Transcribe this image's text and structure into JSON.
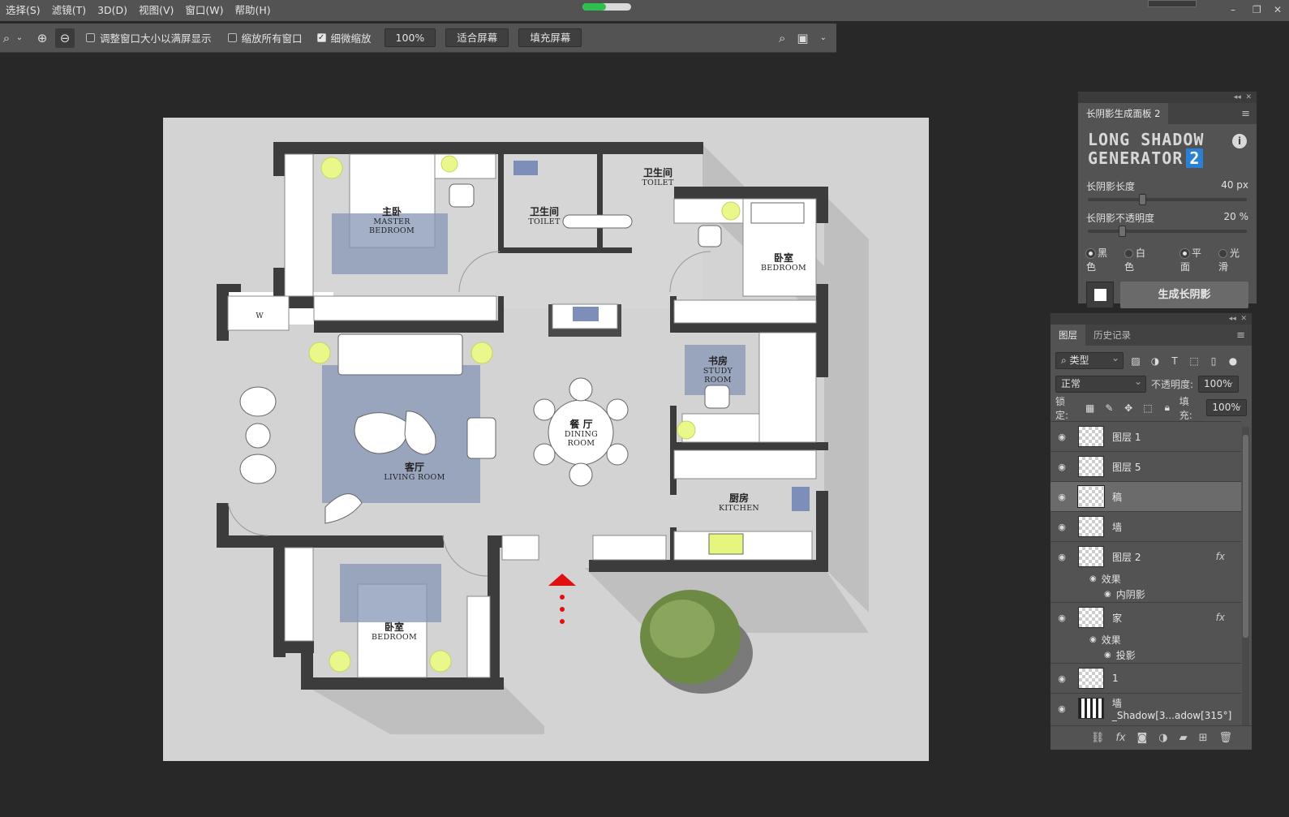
{
  "menu": [
    "选择(S)",
    "滤镜(T)",
    "3D(D)",
    "视图(V)",
    "窗口(W)",
    "帮助(H)"
  ],
  "progress_fraction": 0.48,
  "options_bar": {
    "chk_resize": "调整窗口大小以满屏显示",
    "chk_zoom_all": "缩放所有窗口",
    "chk_scrubby": "细微缩放",
    "zoom_value": "100%",
    "fit_screen": "适合屏幕",
    "fill_screen": "填充屏幕"
  },
  "plan": {
    "rooms": [
      {
        "cn": "主卧",
        "en": "MASTER BEDROOM"
      },
      {
        "cn": "卫生间",
        "en": "TOILET"
      },
      {
        "cn": "卫生间",
        "en": "TOILET"
      },
      {
        "cn": "卧室",
        "en": "BEDROOM"
      },
      {
        "cn": "书房",
        "en": "STUDY ROOM"
      },
      {
        "cn": "餐 厅",
        "en": "DINING ROOM"
      },
      {
        "cn": "客厅",
        "en": "LIVING ROOM"
      },
      {
        "cn": "厨房",
        "en": "KITCHEN"
      },
      {
        "cn": "卧室",
        "en": "BEDROOM"
      }
    ],
    "washer_label": "W"
  },
  "long_shadow_panel": {
    "tab": "长阴影生成面板 2",
    "brand_line1": "LONG SHADOW",
    "brand_line2": "GENERATOR",
    "brand_version": "2",
    "length_label": "长阴影长度",
    "length_value": "40 px",
    "opacity_label": "长阴影不透明度",
    "opacity_value": "20 %",
    "color_black": "黑色",
    "color_white": "白色",
    "style_flat": "平面",
    "style_smooth": "光滑",
    "generate_button": "生成长阴影"
  },
  "layers_panel": {
    "tabs": [
      "图层",
      "历史记录"
    ],
    "filter_kind": "类型",
    "blend_mode": "正常",
    "opacity_label": "不透明度:",
    "opacity_value": "100%",
    "lock_label": "锁定:",
    "fill_label": "填充:",
    "fill_value": "100%",
    "effects_label": "效果",
    "inner_shadow": "内阴影",
    "drop_shadow": "投影",
    "layers": [
      {
        "name": "图层 1"
      },
      {
        "name": "图层 5"
      },
      {
        "name": "稿"
      },
      {
        "name": "墙"
      },
      {
        "name": "图层 2",
        "fx": "fx"
      },
      {
        "name": "家",
        "fx": "fx"
      },
      {
        "name": "1"
      },
      {
        "name": "墙_Shadow[3...adow[315°]"
      }
    ]
  },
  "colors": {
    "canvas_bg": "#d3d3d3",
    "wall": "#3c3c3c",
    "arrow": "#e01010",
    "accent_blue": "#2b7fd4"
  }
}
